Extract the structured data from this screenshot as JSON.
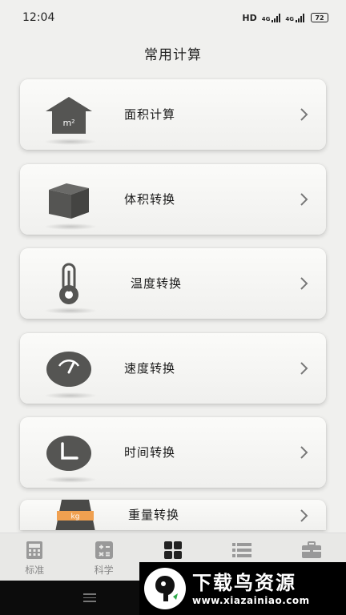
{
  "status_bar": {
    "time": "12:04",
    "network": "HD",
    "signal1": "4G",
    "signal2": "4G",
    "battery": "72"
  },
  "header": {
    "title": "常用计算"
  },
  "items": [
    {
      "label": "面积计算",
      "icon": "house-icon",
      "icon_text": "m²"
    },
    {
      "label": "体积转换",
      "icon": "cube-icon"
    },
    {
      "label": "温度转换",
      "icon": "thermometer-icon"
    },
    {
      "label": "速度转换",
      "icon": "speedometer-icon"
    },
    {
      "label": "时间转换",
      "icon": "clock-icon"
    },
    {
      "label": "重量转换",
      "icon": "weight-icon",
      "icon_text": "kg"
    }
  ],
  "tabs": [
    {
      "label": "标准",
      "icon": "calculator-icon"
    },
    {
      "label": "科学",
      "icon": "scientific-icon"
    },
    {
      "label": "",
      "icon": "grid-icon",
      "active": true
    },
    {
      "label": "",
      "icon": "list-icon"
    },
    {
      "label": "",
      "icon": "briefcase-icon"
    }
  ],
  "watermark": {
    "title": "下载鸟资源",
    "url": "www.xiazainiao.com"
  },
  "colors": {
    "icon_dark": "#555553",
    "accent_orange": "#f0a050",
    "tab_inactive": "#888888",
    "tab_active": "#222222"
  }
}
